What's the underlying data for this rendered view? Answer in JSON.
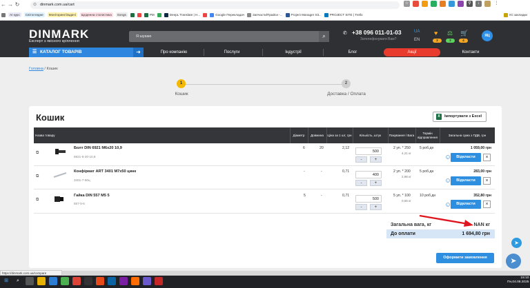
{
  "browser": {
    "url": "dinmark.com.ua/cart",
    "bookmarks": [
      "AI курс",
      "Світоглядне",
      "Моніторинг/Задачі",
      "Щоденна статистика",
      "Songs",
      "",
      "",
      "PM",
      "",
      "DeepL Translate | H...",
      "",
      "Google Перекладач",
      "Запчасти/Прайси -...",
      "Project Manager Sit...",
      "PROJECT SITE | Trello"
    ],
    "bookmarks_folder": "Усі закладки"
  },
  "header": {
    "logo": "DINMARK",
    "tagline": "Експерт з якісного кріплення",
    "search_placeholder": "Я шукаю",
    "phone": "+38 096 011-01-03",
    "callback": "Зателефонувати Вам?",
    "lang_ua": "UA",
    "lang_en": "EN",
    "counters": [
      "2",
      "2",
      "4"
    ],
    "avatar": "ЯЦ"
  },
  "menu": {
    "catalog": "КАТАЛОГ ТОВАРІВ",
    "items": [
      "Про компанію",
      "Послуги",
      "Індустрії",
      "Блог",
      "Акції",
      "Контакти"
    ]
  },
  "breadcrumb": {
    "home": "Головна",
    "sep": " / ",
    "current": "Кошик"
  },
  "steps": [
    {
      "num": "1",
      "label": "Кошик"
    },
    {
      "num": "2",
      "label": "Доставка / Оплата"
    }
  ],
  "cart": {
    "title": "Кошик",
    "excel": "Імпортувати з Excel",
    "columns": [
      "Назва товару",
      "Діаметр",
      "Довжина",
      "Ціна за 1 шт, грн",
      "Кількість, штук",
      "Пакування / Вага",
      "Термін відправлення",
      "Загальна сума з ПДВ, грн"
    ],
    "rows": [
      {
        "name": "Болт DIN 6921 M6x20 10,9",
        "sku": "6921-6-20-10,9",
        "diameter": "6",
        "length": "20",
        "price": "2,12",
        "qty": "500",
        "pack": "2 уп. * 250",
        "weight": "4,21 кг",
        "term": "5 роб.дн",
        "sum": "1 059,00 грн"
      },
      {
        "name": "Конфірмат ART 3401 M7x50 цинк",
        "sku": "3401-7-50ц",
        "diameter": "-",
        "length": "-",
        "price": "0,71",
        "qty": "400",
        "pack": "2 уп. * 200",
        "weight": "2,96 кг",
        "term": "5 роб.дн",
        "sum": "283,00 грн"
      },
      {
        "name": "Гайка DIN 557 M5 5",
        "sku": "557-5-5",
        "diameter": "5",
        "length": "-",
        "price": "0,71",
        "qty": "500",
        "pack": "5 уп. * 100",
        "weight": "0,65 кг",
        "term": "10 роб.дн",
        "sum": "352,80 грн"
      }
    ],
    "minus": "-",
    "plus": "+",
    "delete_btn": "Відкласти",
    "remove": "×",
    "info": "i",
    "total_weight_label": "Загальна вага, кг",
    "total_weight": "NAN кг",
    "to_pay_label": "До оплати",
    "to_pay": "1 694,80 грн",
    "checkout": "Оформити замовлення"
  },
  "status_url": "https://dinmark.com.ua/compare",
  "clock": {
    "time": "15:10",
    "date": "Пн,04.08.2025"
  },
  "colors": {
    "accent": "#2e86de",
    "promo": "#e93b2d",
    "header": "#2f3033"
  }
}
